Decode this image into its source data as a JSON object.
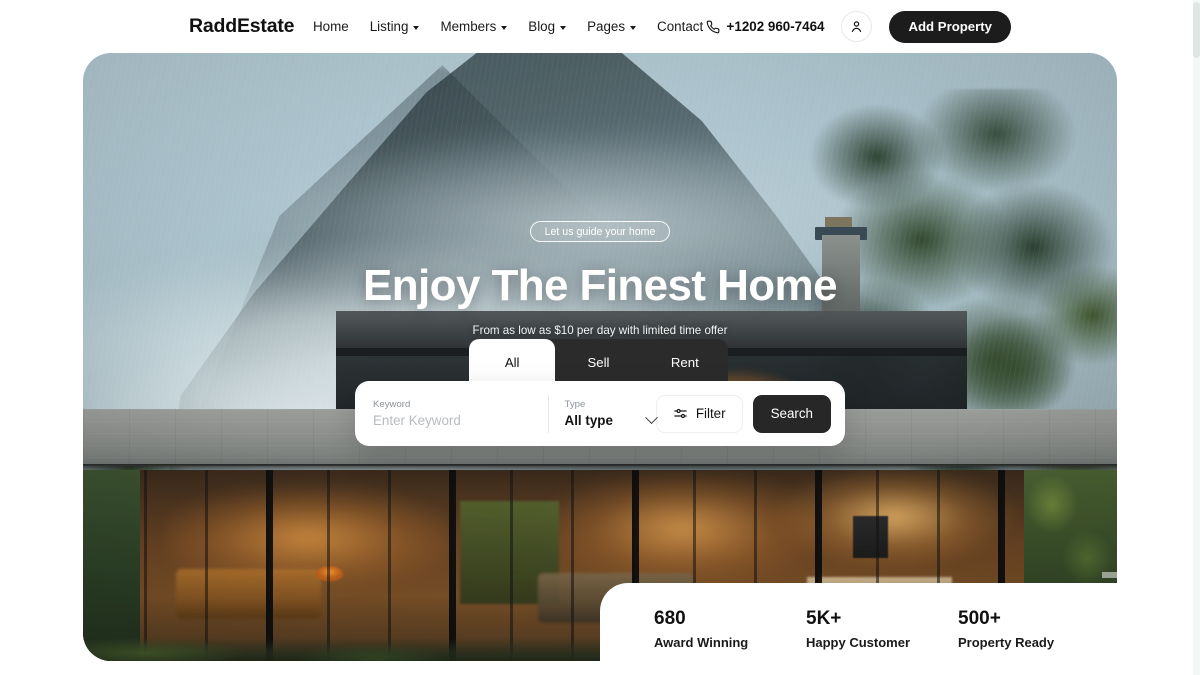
{
  "header": {
    "brand": "RaddEstate",
    "nav": [
      {
        "label": "Home",
        "dropdown": false
      },
      {
        "label": "Listing",
        "dropdown": true
      },
      {
        "label": "Members",
        "dropdown": true
      },
      {
        "label": "Blog",
        "dropdown": true
      },
      {
        "label": "Pages",
        "dropdown": true
      },
      {
        "label": "Contact",
        "dropdown": false
      }
    ],
    "phone": "+1202 960-7464",
    "phone_icon": "phone-icon",
    "account_icon": "user-icon",
    "cta_label": "Add Property"
  },
  "hero": {
    "badge": "Let us guide your home",
    "title": "Enjoy The Finest Home",
    "subtitle": "From as low as $10 per day with limited time offer"
  },
  "search": {
    "tabs": [
      {
        "label": "All",
        "active": true
      },
      {
        "label": "Sell",
        "active": false
      },
      {
        "label": "Rent",
        "active": false
      }
    ],
    "keyword": {
      "label": "Keyword",
      "value": "",
      "placeholder": "Enter Keyword"
    },
    "type": {
      "label": "Type",
      "value": "All type"
    },
    "filter_label": "Filter",
    "filter_icon": "sliders-icon",
    "search_label": "Search"
  },
  "stats": [
    {
      "value": "680",
      "label": "Award Winning"
    },
    {
      "value": "5K+",
      "label": "Happy Customer"
    },
    {
      "value": "500+",
      "label": "Property Ready"
    }
  ],
  "colors": {
    "dark": "#1c1c1c",
    "tab_bar": "#2b2b2b",
    "page_bg": "#ffffff",
    "muted_text": "#8d9499"
  }
}
